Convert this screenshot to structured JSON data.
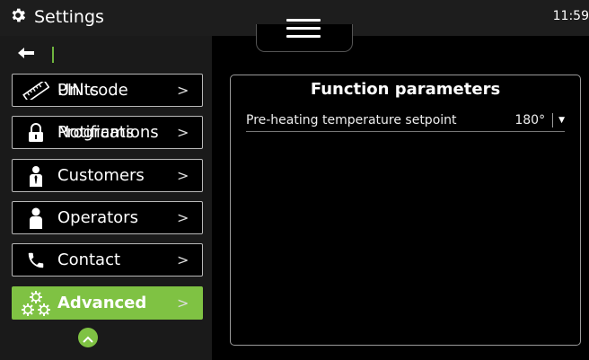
{
  "header": {
    "title": "Settings",
    "time": "11:59",
    "title_icon": "gear-icon",
    "menu_icon": "hamburger-icon"
  },
  "sidebar": {
    "back_icon": "back-arrow-icon",
    "items": [
      {
        "label": "Units",
        "overlay_label": "PIN code",
        "icon": "ruler-icon",
        "active": false
      },
      {
        "label": "Programs",
        "overlay_label": "Notifications",
        "icon": "lock-icon",
        "active": false
      },
      {
        "label": "Customers",
        "icon": "person-tie-icon",
        "active": false
      },
      {
        "label": "Operators",
        "icon": "person-icon",
        "active": false
      },
      {
        "label": "Contact",
        "icon": "phone-icon",
        "active": false
      },
      {
        "label": "Advanced",
        "icon": "gears-icon",
        "active": true
      }
    ],
    "chevron": ">",
    "scroll_up_icon": "chevron-up-icon"
  },
  "panel": {
    "title": "Function parameters",
    "params": [
      {
        "label": "Pre-heating temperature setpoint",
        "value": "180°"
      }
    ]
  },
  "colors": {
    "accent": "#7fc243",
    "topbar": "#1d1d1d",
    "sidebar": "#1a1a1a"
  }
}
